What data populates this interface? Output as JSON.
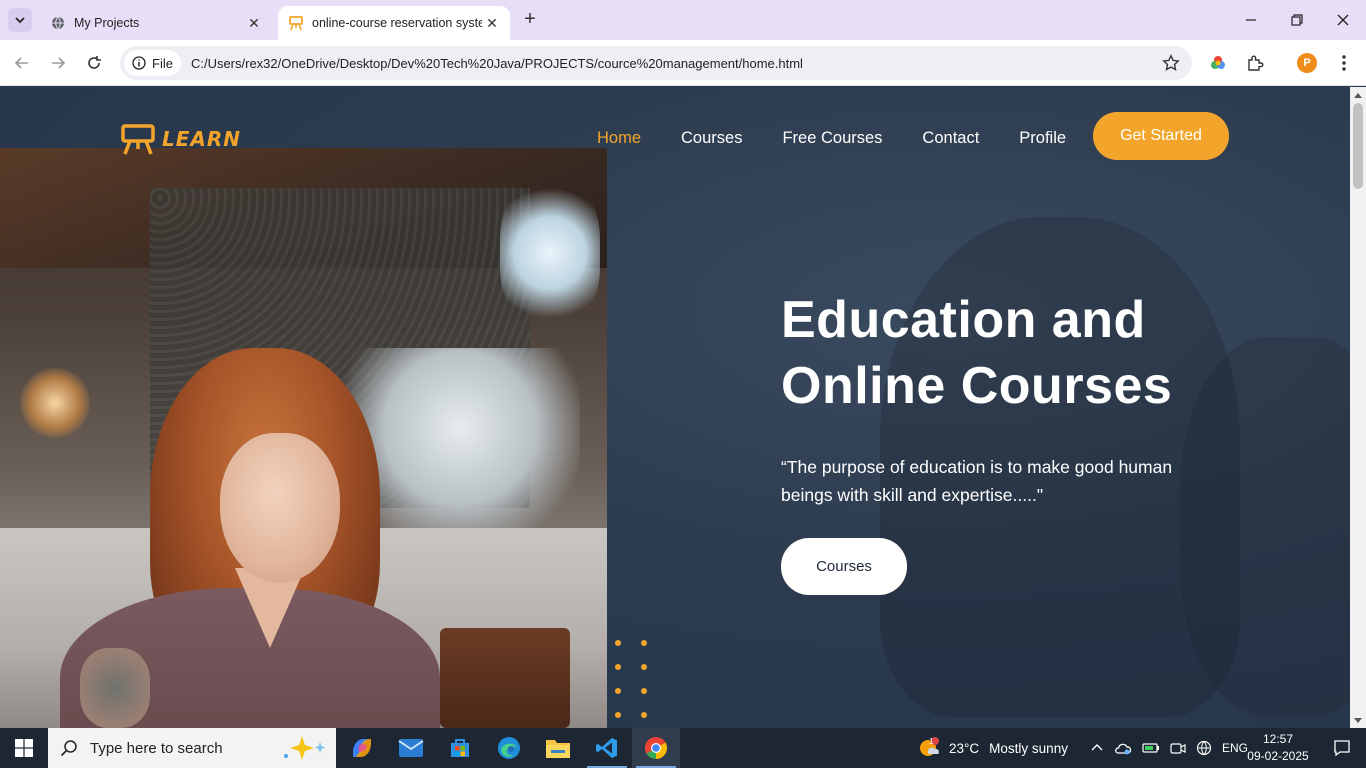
{
  "browser": {
    "tabs": [
      {
        "title": "My Projects",
        "active": false
      },
      {
        "title": "online-course reservation system",
        "active": true
      }
    ],
    "site_chip": "File",
    "url": "C:/Users/rex32/OneDrive/Desktop/Dev%20Tech%20Java/PROJECTS/cource%20management/home.html",
    "profile_initial": "P"
  },
  "site": {
    "logo_text": "LEARN",
    "nav": [
      "Home",
      "Courses",
      "Free Courses",
      "Contact",
      "Profile"
    ],
    "active_nav": "Home",
    "cta_label": "Get Started",
    "hero": {
      "title_line1": "Education and",
      "title_line2": "Online Courses",
      "quote": "“The purpose of education is to make good human beings with skill and expertise.....\"",
      "button_label": "Courses"
    },
    "accent_color": "#f3a52b",
    "background_color": "#2b3a4e"
  },
  "taskbar": {
    "search_placeholder": "Type here to search",
    "weather": {
      "temp": "23°C",
      "desc": "Mostly sunny",
      "badge": "1"
    },
    "language": "ENG",
    "time": "12:57",
    "date": "09-02-2025"
  }
}
